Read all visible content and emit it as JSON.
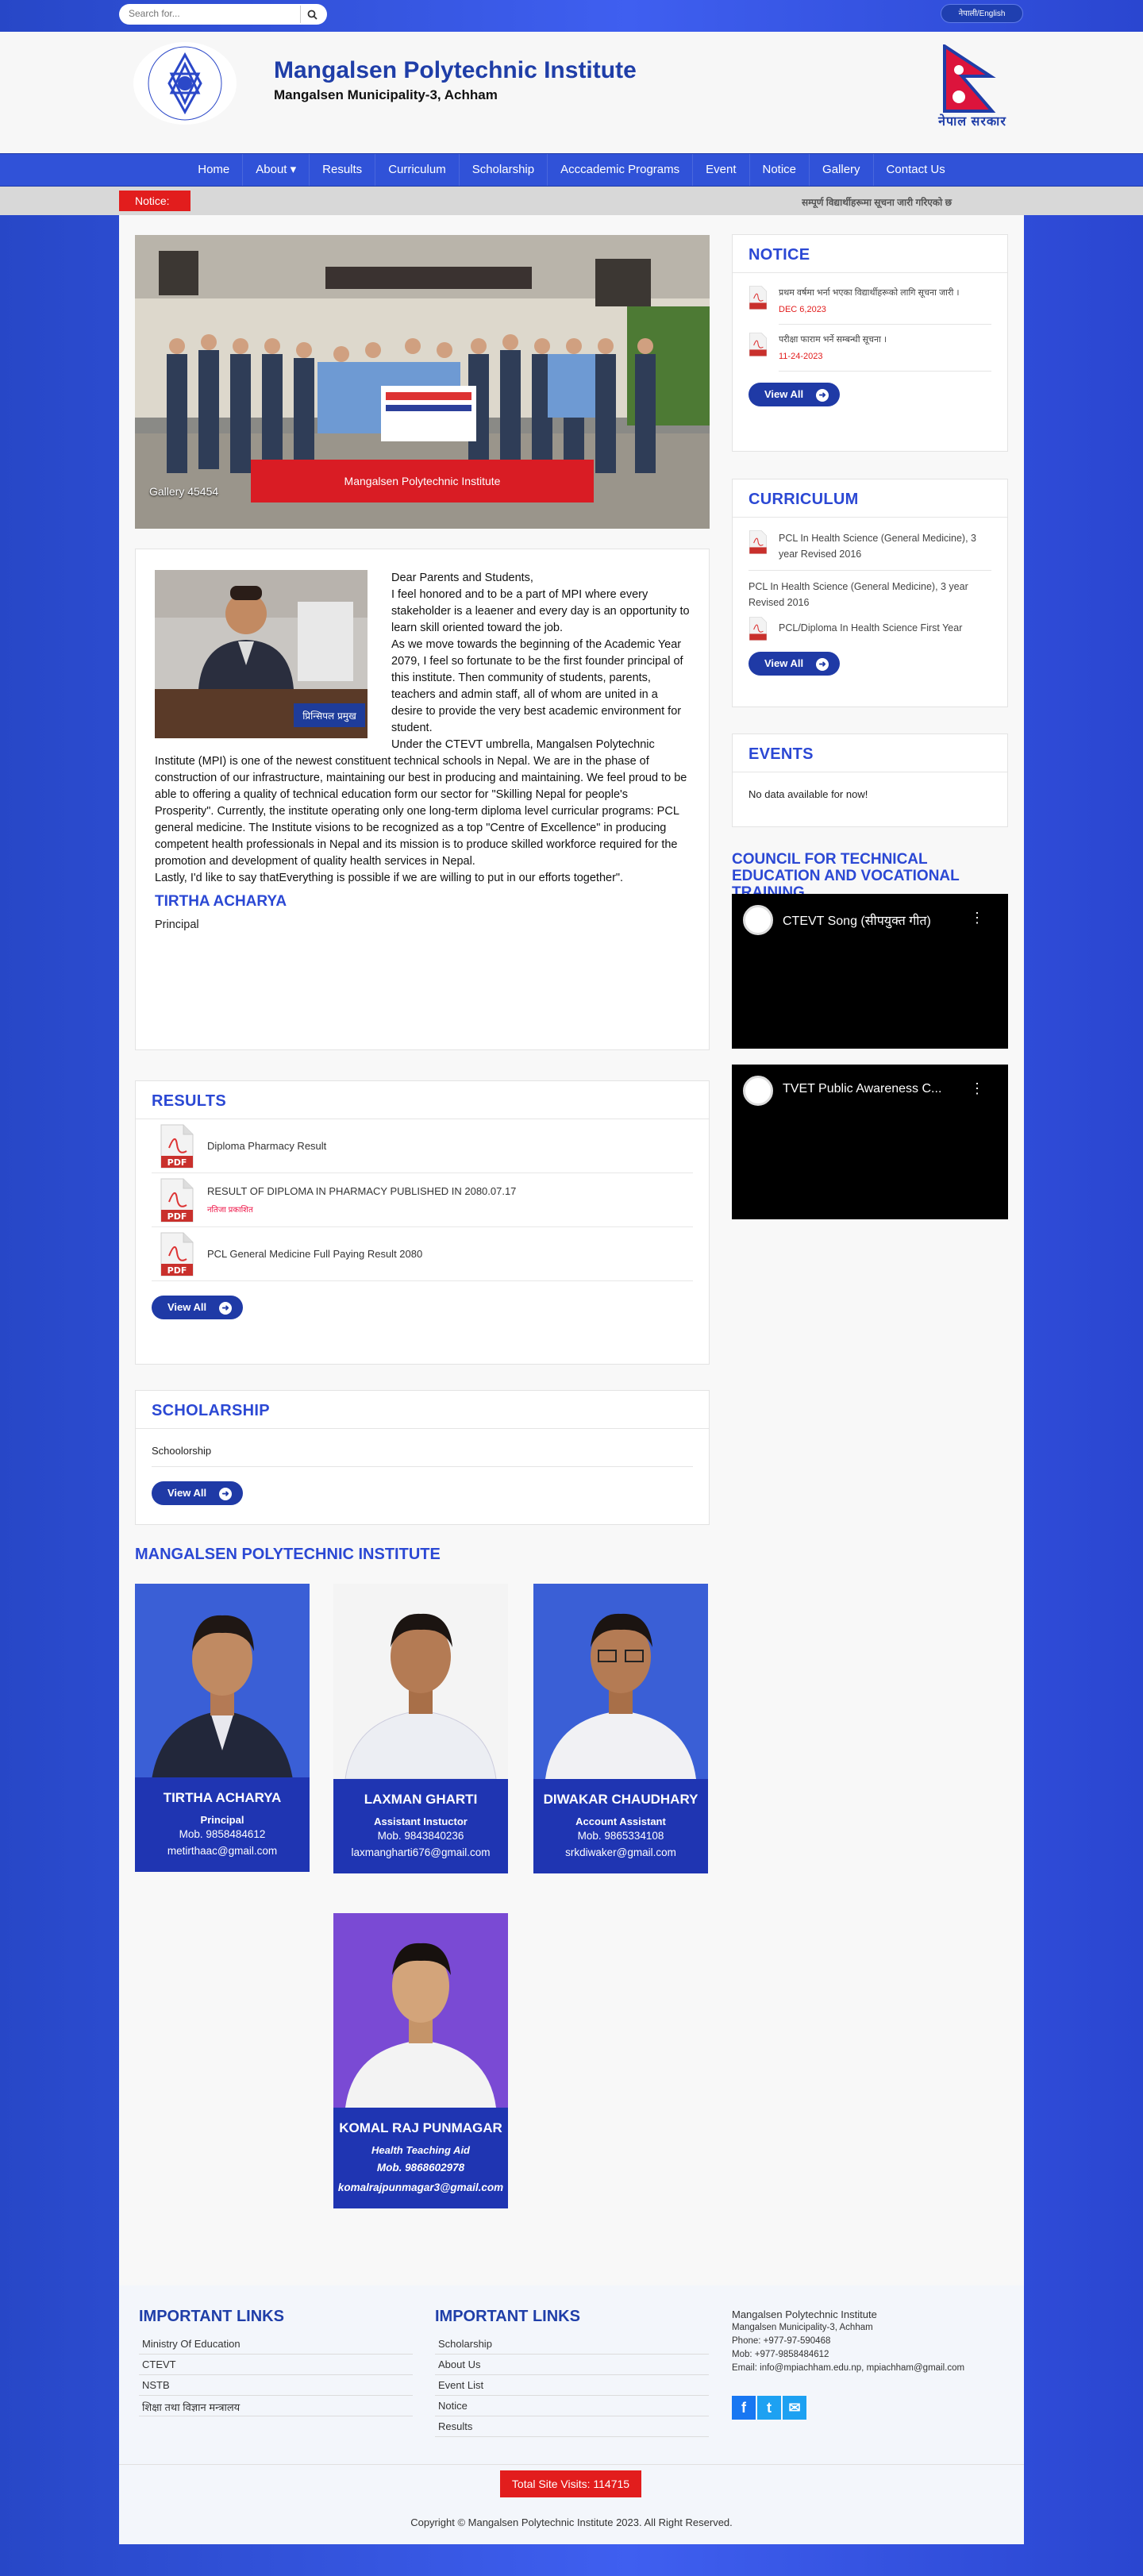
{
  "search": {
    "placeholder": "Search for..."
  },
  "language_toggle": "नेपाली/English",
  "header": {
    "title": "Mangalsen Polytechnic Institute",
    "subtitle": "Mangalsen Municipality-3, Achham",
    "flag_caption": "नेपाल सरकार"
  },
  "nav": {
    "items": [
      "Home",
      "About ▾",
      "Results",
      "Curriculum",
      "Scholarship",
      "Acccademic Programs",
      "Event",
      "Notice",
      "Gallery",
      "Contact Us"
    ]
  },
  "notice_bar": {
    "label": "Notice:",
    "scroll_text": "सम्पूर्ण विद्यार्थीहरूमा सूचना जारी गरिएको छ"
  },
  "slider": {
    "caption": "Mangalsen Polytechnic Institute",
    "gallery_tag": "Gallery 45454"
  },
  "message": {
    "greeting": "Dear Parents and Students,",
    "paragraphs": [
      "I feel honored and to be a part of MPI where every stakeholder is a leaener and every day is an opportunity to learn skill oriented toward the job.",
      "As we move towards the beginning of the Academic Year 2079, I feel so fortunate to be the first founder principal of this institute. Then community of students, parents, teachers and admin staff, all of whom are united in a desire to provide the very best academic environment for student.",
      "Under the CTEVT umbrella, Mangalsen Polytechnic Institute (MPI) is one of the newest constituent technical schools in Nepal. We are in the phase of construction of our infrastructure, maintaining our best in producing and maintaining. We feel proud to be able to offering a quality of technical education form our sector for \"Skilling Nepal for people's Prosperity\". Currently, the institute operating only one long-term diploma level curricular programs: PCL general medicine. The Institute visions to be recognized as a top \"Centre of Excellence\" in producing competent health professionals in Nepal and its mission is to produce skilled workforce required for the promotion and development of quality health services in Nepal.",
      "Lastly, I'd like to say thatEverything is possible if we are willing to put in our efforts together\"."
    ],
    "name": "TIRTHA ACHARYA",
    "role": "Principal",
    "badge": "प्रिन्सिपल प्रमुख"
  },
  "results": {
    "title": "RESULTS",
    "items": [
      {
        "text": "Diploma Pharmacy Result",
        "sub": ""
      },
      {
        "text": "RESULT OF DIPLOMA IN PHARMACY PUBLISHED IN 2080.07.17",
        "sub": "नतिजा प्रकाशित"
      },
      {
        "text": "PCL General Medicine Full Paying Result 2080",
        "sub": ""
      }
    ],
    "view_all": "View All"
  },
  "scholarship": {
    "title": "SCHOLARSHIP",
    "item": "Schoolorship",
    "view_all": "View All"
  },
  "staff": {
    "title": "MANGALSEN POLYTECHNIC INSTITUTE",
    "members": [
      {
        "name": "TIRTHA ACHARYA",
        "role": "Principal",
        "mob": "Mob. 9858484612",
        "email": "metirthaac@gmail.com"
      },
      {
        "name": "LAXMAN GHARTI",
        "role": "Assistant Instuctor",
        "mob": "Mob. 9843840236",
        "email": "laxmangharti676@gmail.com"
      },
      {
        "name": "DIWAKAR CHAUDHARY",
        "role": "Account Assistant",
        "mob": "Mob. 9865334108",
        "email": "srkdiwaker@gmail.com"
      },
      {
        "name": "KOMAL RAJ PUNMAGAR",
        "role": "Health Teaching Aid",
        "mob": "Mob. 9868602978",
        "email": "komalrajpunmagar3@gmail.com"
      }
    ]
  },
  "notice": {
    "title": "NOTICE",
    "items": [
      {
        "text": "प्रथम वर्षमा भर्ना भएका विद्यार्थीहरूको लागि सूचना जारी ।",
        "date": "DEC 6,2023"
      },
      {
        "text": "परीक्षा फाराम भर्ने सम्बन्धी सूचना ।",
        "date": "11-24-2023"
      }
    ],
    "view_all": "View All"
  },
  "curriculum": {
    "title": "CURRICULUM",
    "items": [
      "PCL In Health Science (General Medicine), 3 year Revised 2016",
      "PCL In Health Science (General Medicine), 3 year Revised 2016",
      "PCL/Diploma In Health Science First Year"
    ],
    "view_all": "View All"
  },
  "events": {
    "title": "EVENTS",
    "empty": "No data available for now!"
  },
  "ctevt": {
    "title": "COUNCIL FOR TECHNICAL EDUCATION AND VOCATIONAL TRAINING",
    "videos": [
      "CTEVT Song (सीपयुक्त गीत)",
      "TVET Public Awareness C..."
    ]
  },
  "footer": {
    "links1_title": "IMPORTANT LINKS",
    "links1": [
      "Ministry Of Education",
      "CTEVT",
      "NSTB",
      "शिक्षा तथा विज्ञान मन्त्रालय"
    ],
    "links2_title": "IMPORTANT LINKS",
    "links2": [
      "Scholarship",
      "About Us",
      "Event List",
      "Notice",
      "Results"
    ],
    "org_name": "Mangalsen Polytechnic Institute",
    "address": "Mangalsen Municipality-3, Achham",
    "phone": "Phone: +977-97-590468",
    "mob": "Mob: +977-9858484612",
    "email": "Email: info@mpiachham.edu.np, mpiachham@gmail.com",
    "visits": "Total Site Visits: 114715",
    "copyright": "Copyright © Mangalsen Polytechnic Institute 2023. All Right Reserved."
  }
}
